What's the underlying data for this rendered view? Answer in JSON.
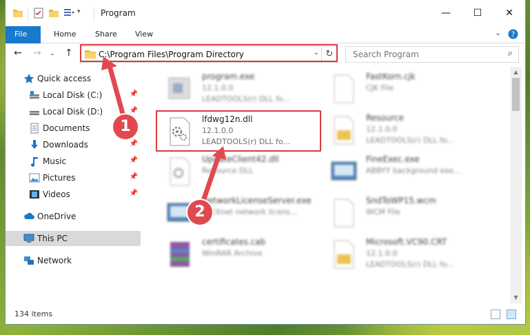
{
  "window": {
    "title": "Program",
    "controls": {
      "minimize": "—",
      "maximize": "☐",
      "close": "✕"
    }
  },
  "ribbon": {
    "tabs": [
      {
        "label": "File"
      },
      {
        "label": "Home"
      },
      {
        "label": "Share"
      },
      {
        "label": "View"
      }
    ],
    "expand_icon": "chevron-down",
    "help_icon": "help"
  },
  "nav": {
    "address_path": "C:\\Program Files\\Program Directory",
    "search_placeholder": "Search Program"
  },
  "sidebar": {
    "items": [
      {
        "label": "Quick access",
        "icon": "star-icon",
        "pinned": false
      },
      {
        "label": "Local Disk (C:)",
        "icon": "drive-icon",
        "pinned": true
      },
      {
        "label": "Local Disk (D:)",
        "icon": "drive-icon",
        "pinned": true
      },
      {
        "label": "Documents",
        "icon": "documents-icon",
        "pinned": true
      },
      {
        "label": "Downloads",
        "icon": "downloads-icon",
        "pinned": true
      },
      {
        "label": "Music",
        "icon": "music-icon",
        "pinned": true
      },
      {
        "label": "Pictures",
        "icon": "pictures-icon",
        "pinned": true
      },
      {
        "label": "Videos",
        "icon": "videos-icon",
        "pinned": true
      },
      {
        "label": "OneDrive",
        "icon": "cloud-icon",
        "pinned": false
      },
      {
        "label": "This PC",
        "icon": "computer-icon",
        "pinned": false
      },
      {
        "label": "Network",
        "icon": "network-icon",
        "pinned": false
      }
    ]
  },
  "files": {
    "left": [
      {
        "name": "program.exe",
        "line2": "12.1.0.0",
        "line3": "LEADTOOLS(r) DLL fo...",
        "blurred": true
      },
      {
        "name": "lfdwg12n.dll",
        "line2": "12.1.0.0",
        "line3": "LEADTOOLS(r) DLL fo...",
        "blurred": false
      },
      {
        "name": "UpdateClient42.dll",
        "line2": "Resource DLL",
        "line3": "",
        "blurred": true
      },
      {
        "name": "NetworkLicenseServer.exe",
        "line2": "FLEXnet network licens...",
        "line3": "",
        "blurred": true
      },
      {
        "name": "certificates.cab",
        "line2": "WinRAR Archive",
        "line3": "",
        "blurred": true
      }
    ],
    "right": [
      {
        "name": "FastKorn.cjk",
        "line2": "CJK File",
        "line3": "",
        "blurred": true
      },
      {
        "name": "Resource",
        "line2": "12.1.0.0",
        "line3": "LEADTOOLS(r) DLL fo...",
        "blurred": true
      },
      {
        "name": "FineExec.exe",
        "line2": "ABBYY background exe...",
        "line3": "",
        "blurred": true
      },
      {
        "name": "SndToWP15.wcm",
        "line2": "WCM File",
        "line3": "",
        "blurred": true
      },
      {
        "name": "Microsoft.VC90.CRT",
        "line2": "12.1.0.0",
        "line3": "LEADTOOLS(r) DLL fo...",
        "blurred": true
      }
    ]
  },
  "status": {
    "item_count": "134 items"
  },
  "callouts": {
    "step1": "1",
    "step2": "2"
  },
  "colors": {
    "accent": "#1979ca",
    "highlight": "#d93a3f",
    "badge": "#e04a4f"
  }
}
